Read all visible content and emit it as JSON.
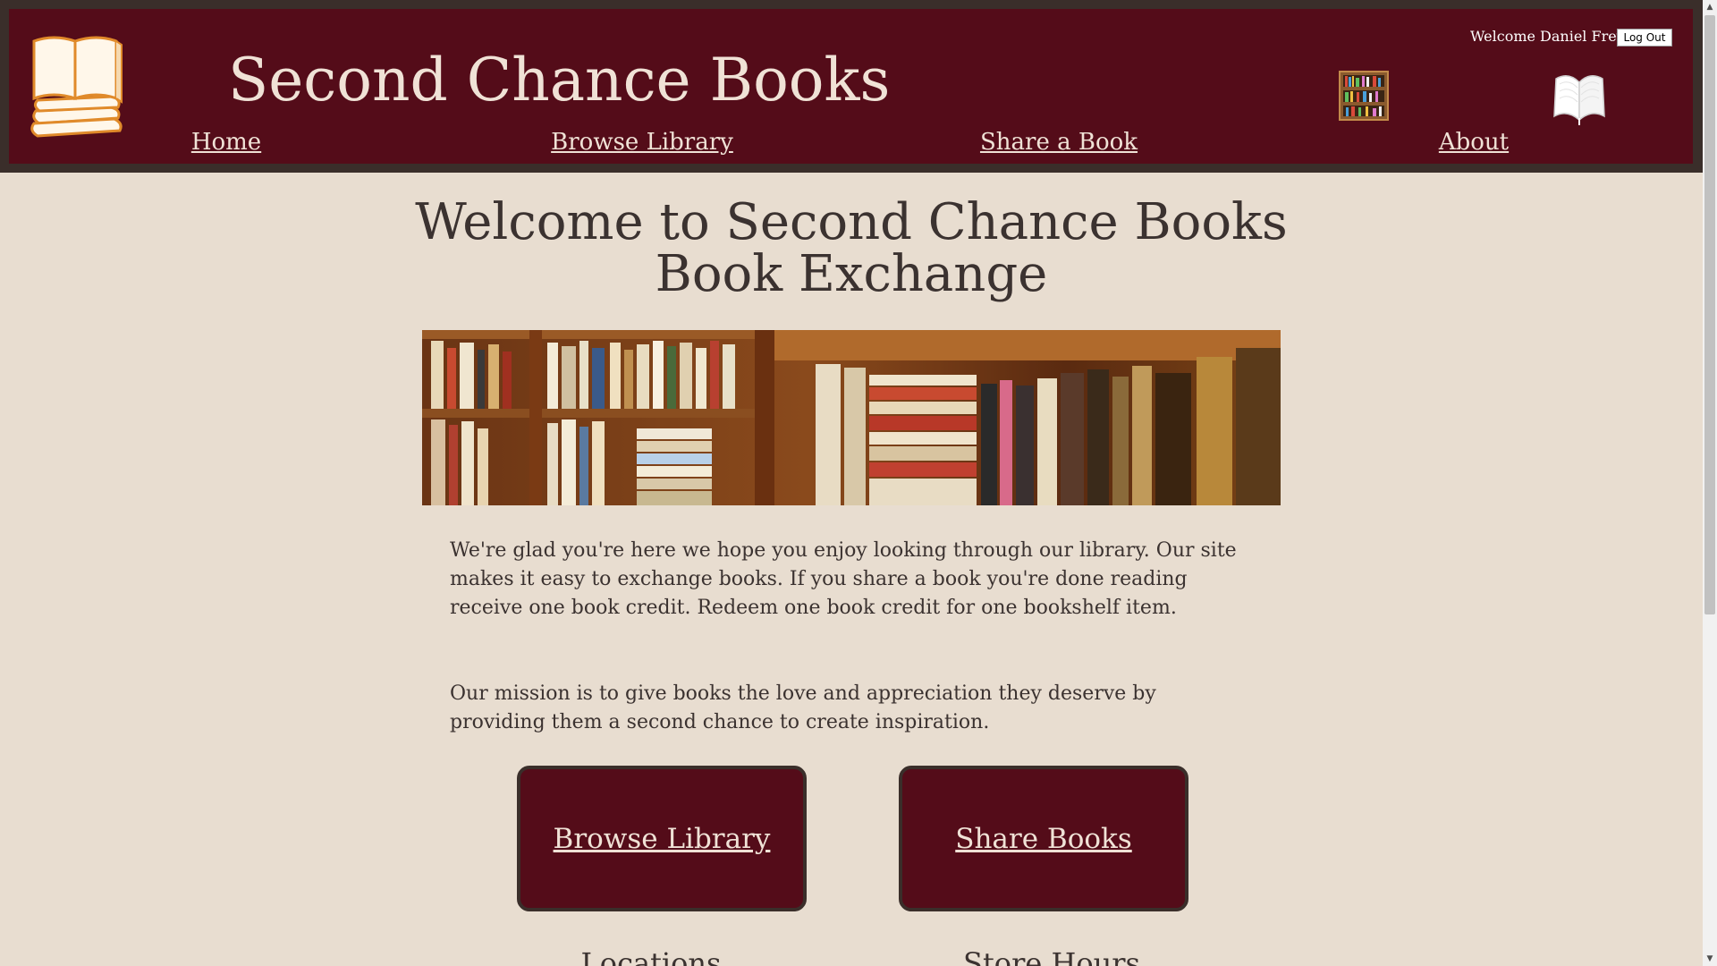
{
  "header": {
    "site_title": "Second Chance Books",
    "welcome_text": "Welcome Daniel Frey",
    "logout_label": "Log Out",
    "nav": [
      {
        "label": "Home"
      },
      {
        "label": "Browse Library"
      },
      {
        "label": "Share a Book"
      },
      {
        "label": "About"
      }
    ]
  },
  "main": {
    "title_line1": "Welcome to Second Chance Books",
    "title_line2": "Book Exchange",
    "intro": "We're glad you're here we hope you enjoy looking through our library. Our site makes it easy to exchange books. If you share a book you're done reading receive one book credit. Redeem one book credit for one bookshelf item.",
    "mission": "Our mission is to give books the love and appreciation they deserve by providing them a second chance to create inspiration.",
    "buttons": {
      "browse": "Browse Library",
      "share": "Share Books"
    },
    "sections": {
      "locations": "Locations",
      "hours": "Store Hours"
    }
  },
  "icons": {
    "logo": "book-stack-logo-icon",
    "shelf": "bookshelf-icon",
    "open_book": "open-book-icon",
    "scroll_up": "▲",
    "scroll_down": "▼"
  },
  "colors": {
    "header_bg": "#540c19",
    "header_frame": "#3a2e2a",
    "page_bg": "#e8ddd0",
    "header_text": "#f0e2d6",
    "body_text": "#3b3230"
  }
}
